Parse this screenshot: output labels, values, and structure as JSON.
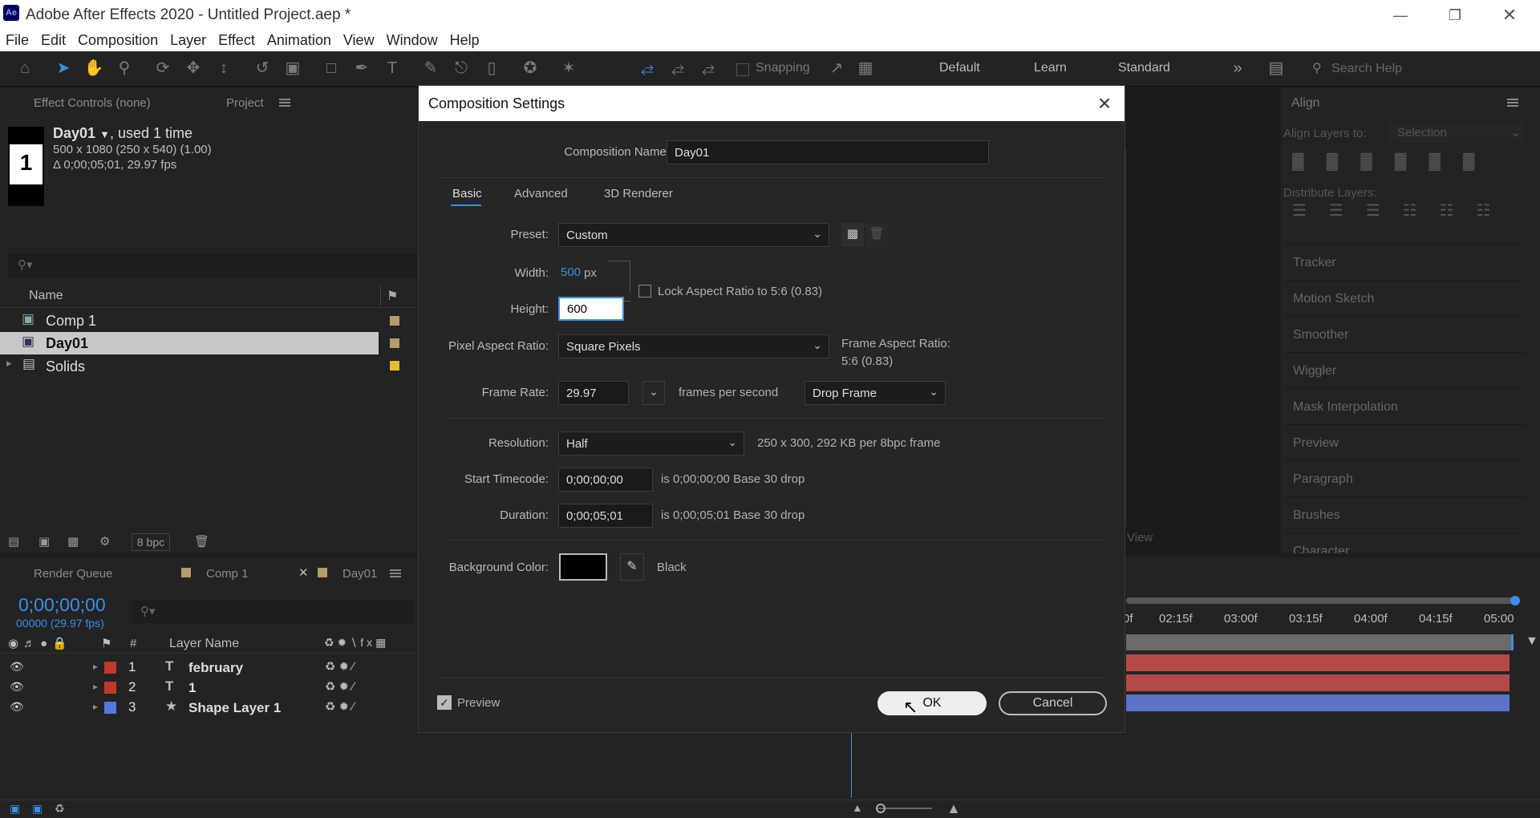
{
  "app": {
    "title": "Adobe After Effects 2020 - Untitled Project.aep *",
    "logo_text": "Ae"
  },
  "menu": [
    "File",
    "Edit",
    "Composition",
    "Layer",
    "Effect",
    "Animation",
    "View",
    "Window",
    "Help"
  ],
  "toolbar": {
    "snapping": "Snapping",
    "workspaces": [
      "Default",
      "Learn",
      "Standard"
    ],
    "search_placeholder": "Search Help"
  },
  "project_panel": {
    "tab_effect_controls": "Effect Controls",
    "tab_effect_controls_value": "(none)",
    "tab_project": "Project",
    "thumb_name": "Day01",
    "used": ", used 1 time",
    "info_size": "500 x 1080  (250 x 540) (1.00)",
    "info_duration": "Δ 0;00;05;01, 29.97 fps",
    "col_name": "Name",
    "items": [
      {
        "name": "Comp 1",
        "type": "comp",
        "color": "#b59b6e"
      },
      {
        "name": "Day01",
        "type": "comp",
        "color": "#b59b6e",
        "selected": true
      },
      {
        "name": "Solids",
        "type": "folder",
        "color": "#e0c030"
      }
    ],
    "bpc": "8 bpc"
  },
  "timeline": {
    "tabs": [
      "Render Queue",
      "Comp 1",
      "Day01"
    ],
    "timecode": "0;00;00;00",
    "frames": "00000 (29.97 fps)",
    "col_num": "#",
    "col_layer": "Layer Name",
    "layers": [
      {
        "num": "1",
        "type": "T",
        "name": "february",
        "color": "#c0392b"
      },
      {
        "num": "2",
        "type": "T",
        "name": "1",
        "color": "#c0392b"
      },
      {
        "num": "3",
        "type": "★",
        "name": "Shape Layer 1",
        "color": "#5578e0"
      }
    ],
    "ruler": [
      "0f",
      "02:15f",
      "03:00f",
      "03:15f",
      "04:00f",
      "04:15f",
      "05:00"
    ],
    "view_label": "View"
  },
  "right_panel": {
    "align_title": "Align",
    "align_to_label": "Align Layers to:",
    "align_to_value": "Selection",
    "distribute_label": "Distribute Layers:",
    "sections": [
      "Tracker",
      "Motion Sketch",
      "Smoother",
      "Wiggler",
      "Mask Interpolation",
      "Preview",
      "Paragraph",
      "Brushes",
      "Character"
    ]
  },
  "dialog": {
    "title": "Composition Settings",
    "comp_name_label": "Composition Name:",
    "comp_name": "Day01",
    "tabs": [
      "Basic",
      "Advanced",
      "3D Renderer"
    ],
    "preset_label": "Preset:",
    "preset": "Custom",
    "width_label": "Width:",
    "width": "500",
    "px": "px",
    "height_label": "Height:",
    "height": "600",
    "lock_label": "Lock Aspect Ratio to 5:6 (0.83)",
    "par_label": "Pixel Aspect Ratio:",
    "par": "Square Pixels",
    "far_label": "Frame Aspect Ratio:",
    "far": "5:6 (0.83)",
    "fr_label": "Frame Rate:",
    "fr": "29.97",
    "fps": "frames per second",
    "drop": "Drop Frame",
    "res_label": "Resolution:",
    "res": "Half",
    "res_info": "250 x 300, 292 KB per 8bpc frame",
    "start_label": "Start Timecode:",
    "start": "0;00;00;00",
    "start_info": "is 0;00;00;00  Base 30  drop",
    "dur_label": "Duration:",
    "dur": "0;00;05;01",
    "dur_info": "is 0;00;05;01  Base 30  drop",
    "bg_label": "Background Color:",
    "bg_name": "Black",
    "bg_color": "#000000",
    "preview": "Preview",
    "ok": "OK",
    "cancel": "Cancel"
  }
}
